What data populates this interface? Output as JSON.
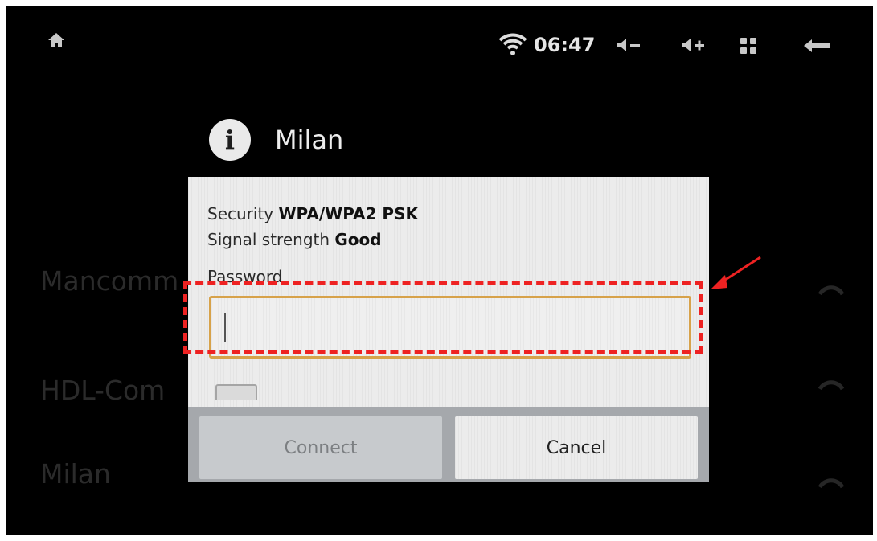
{
  "status_bar": {
    "time": "06:47",
    "icons": [
      "home-icon",
      "wifi-icon",
      "volume-down-icon",
      "volume-up-icon",
      "apps-icon",
      "back-icon"
    ]
  },
  "background_list": {
    "items": [
      {
        "label": "Mancomm"
      },
      {
        "label": "HDL-Com"
      },
      {
        "label": "Milan"
      }
    ]
  },
  "dialog": {
    "title": "Milan",
    "security_label": "Security",
    "security_value": "WPA/WPA2 PSK",
    "signal_label": "Signal strength",
    "signal_value": "Good",
    "password_label": "Password",
    "password_value": "",
    "connect_label": "Connect",
    "cancel_label": "Cancel",
    "connect_enabled": false
  },
  "annotation": {
    "color": "#ee2222",
    "style": "dashed-box-with-arrow"
  },
  "colors": {
    "field_focus_border": "#d7a24a",
    "screen_background": "#000000"
  }
}
